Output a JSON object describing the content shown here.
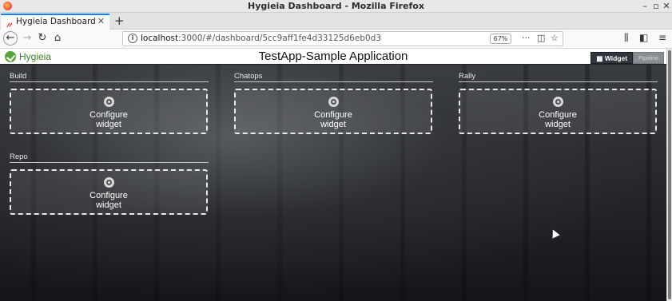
{
  "window": {
    "title": "Hygieia Dashboard - Mozilla Firefox"
  },
  "tab": {
    "label": "Hygieia Dashboard"
  },
  "urlbar": {
    "host": "localhost",
    "path": ":3000/#/dashboard/5cc9aff1fe4d33125d6eb0d3",
    "zoom": "67%"
  },
  "app": {
    "logo_text": "Hygieia",
    "title": "TestApp-Sample Application",
    "view_toggle": {
      "widget_label": "Widget",
      "pipeline_label": "Pipeline"
    }
  },
  "widgets": [
    {
      "title": "Build",
      "line1": "Configure",
      "line2": "widget"
    },
    {
      "title": "Chatops",
      "line1": "Configure",
      "line2": "widget"
    },
    {
      "title": "Rally",
      "line1": "Configure",
      "line2": "widget"
    },
    {
      "title": "Repo",
      "line1": "Configure",
      "line2": "widget"
    }
  ]
}
